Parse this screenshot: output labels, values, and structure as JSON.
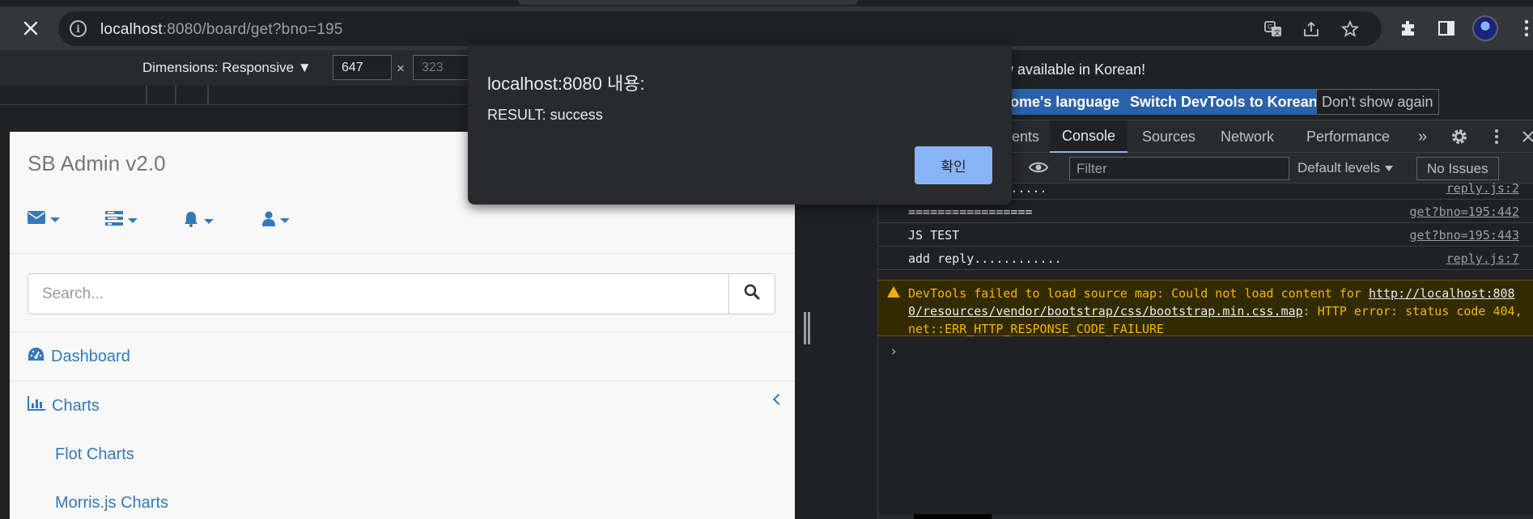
{
  "browser": {
    "url_host": "localhost",
    "url_rest": ":8080/board/get?bno=195",
    "icons": [
      "close-icon",
      "info-icon",
      "translate-icon",
      "share-icon",
      "star-icon",
      "extensions-icon",
      "side-panel-icon",
      "profile-avatar",
      "menu-icon"
    ]
  },
  "device_toolbar": {
    "dimensions_label": "Dimensions: Responsive",
    "width_value": "647",
    "height_placeholder": "323",
    "separator": "×"
  },
  "page": {
    "brand": "SB Admin v2.0",
    "nav_icons": [
      "envelope-icon",
      "tasks-icon",
      "bell-icon",
      "user-icon"
    ],
    "search_placeholder": "Search...",
    "menu": {
      "dashboard": "Dashboard",
      "charts": "Charts",
      "flot": "Flot Charts",
      "morris": "Morris.js Charts"
    },
    "link_color": "#337ab7"
  },
  "dialog": {
    "title": "localhost:8080 내용:",
    "message": "RESULT: success",
    "ok_label": "확인",
    "ok_color": "#8ab4f8"
  },
  "devtools": {
    "infobar": {
      "text": "w available in Korean!",
      "btn_language": "ome's language",
      "btn_switch": "Switch DevTools to Korean",
      "btn_dismiss": "Don't show again"
    },
    "tabs": [
      "ents",
      "Console",
      "Sources",
      "Network",
      "Performance",
      "»"
    ],
    "active_tab": "Console",
    "filter_placeholder": "Filter",
    "levels_label": "Default levels",
    "issues_label": "No Issues",
    "logs": [
      {
        "msg": "reply Module.......",
        "src": "reply.js:2"
      },
      {
        "msg": "=================",
        "src": "get?bno=195:442"
      },
      {
        "msg": "JS TEST",
        "src": "get?bno=195:443"
      },
      {
        "msg": "add reply............",
        "src": "reply.js:7"
      }
    ],
    "warning": {
      "prefix": "DevTools failed to load source map: Could not load content for ",
      "link": "http://localhost:8080/resources/vendor/bootstrap/css/bootstrap.min.css.map",
      "suffix": ": HTTP error: status code 404, net::ERR_HTTP_RESPONSE_CODE_FAILURE"
    },
    "prompt": "›",
    "warning_color": "#f2b600",
    "accent_color": "#8ab4f8"
  }
}
